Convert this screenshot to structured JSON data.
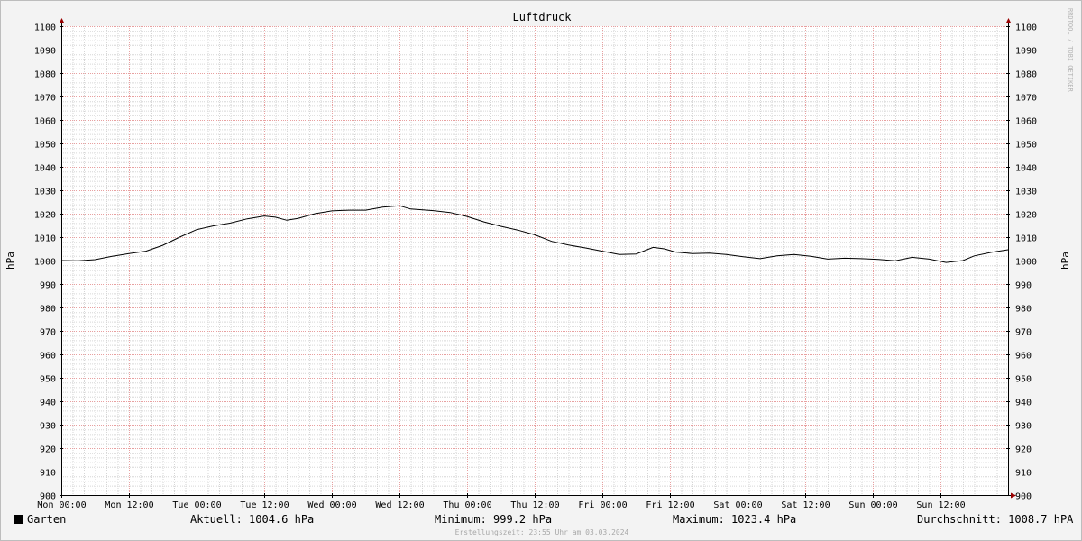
{
  "chart_data": {
    "type": "line",
    "title": "Luftdruck",
    "ylabel": "hPa",
    "ylabel_right": "hPa",
    "ylim": [
      900,
      1100
    ],
    "y_ticks": [
      900,
      910,
      920,
      930,
      940,
      950,
      960,
      970,
      980,
      990,
      1000,
      1010,
      1020,
      1030,
      1040,
      1050,
      1060,
      1070,
      1080,
      1090,
      1100
    ],
    "xlim_hours": [
      0,
      168
    ],
    "x_ticks": [
      {
        "label": "Mon 00:00",
        "hour": 0
      },
      {
        "label": "Mon 12:00",
        "hour": 12
      },
      {
        "label": "Tue 00:00",
        "hour": 24
      },
      {
        "label": "Tue 12:00",
        "hour": 36
      },
      {
        "label": "Wed 00:00",
        "hour": 48
      },
      {
        "label": "Wed 12:00",
        "hour": 60
      },
      {
        "label": "Thu 00:00",
        "hour": 72
      },
      {
        "label": "Thu 12:00",
        "hour": 84
      },
      {
        "label": "Fri 00:00",
        "hour": 96
      },
      {
        "label": "Fri 12:00",
        "hour": 108
      },
      {
        "label": "Sat 00:00",
        "hour": 120
      },
      {
        "label": "Sat 12:00",
        "hour": 132
      },
      {
        "label": "Sun 00:00",
        "hour": 144
      },
      {
        "label": "Sun 12:00",
        "hour": 156
      }
    ],
    "grid": true,
    "colors": {
      "background": "#f3f3f3",
      "plot": "#ffffff",
      "grid_minor": "#d6d6d6",
      "grid_major": "#e8a0a0",
      "axis": "#000000",
      "line": "#000000",
      "arrow": "#990000"
    },
    "series": [
      {
        "name": "Garten",
        "color": "#000000",
        "x": [
          0,
          3,
          6,
          9,
          12,
          15,
          18,
          21,
          24,
          27,
          30,
          33,
          36,
          38,
          40,
          42,
          45,
          48,
          51,
          54,
          57,
          60,
          62,
          66,
          69,
          72,
          75,
          78,
          81,
          84,
          87,
          90,
          93,
          96,
          99,
          102,
          105,
          107,
          109,
          112,
          115,
          118,
          121,
          124,
          127,
          130,
          133,
          136,
          139,
          142,
          145,
          148,
          151,
          154,
          157,
          160,
          162,
          165,
          168
        ],
        "y": [
          1000.0,
          999.9,
          1000.4,
          1001.8,
          1003.0,
          1004.0,
          1006.5,
          1010.0,
          1013.2,
          1014.8,
          1016.0,
          1017.8,
          1019.0,
          1018.5,
          1017.2,
          1018.0,
          1020.0,
          1021.2,
          1021.5,
          1021.5,
          1022.8,
          1023.4,
          1022.0,
          1021.3,
          1020.5,
          1018.8,
          1016.5,
          1014.6,
          1013.0,
          1011.0,
          1008.2,
          1006.6,
          1005.4,
          1004.0,
          1002.6,
          1002.8,
          1005.6,
          1005.0,
          1003.6,
          1003.0,
          1003.2,
          1002.6,
          1001.6,
          1000.8,
          1002.0,
          1002.6,
          1001.8,
          1000.6,
          1001.0,
          1000.8,
          1000.5,
          999.9,
          1001.4,
          1000.6,
          999.2,
          1000.0,
          1002.0,
          1003.5,
          1004.6
        ]
      }
    ]
  },
  "watermark": "RRDTOOL / TOBI OETIKER",
  "legend": {
    "series_name": "Garten",
    "current": "Aktuell: 1004.6 hPa",
    "minimum": "Minimum: 999.2 hPa",
    "maximum": "Maximum: 1023.4 hPa",
    "average": "Durchschnitt: 1008.7 hPA"
  },
  "footer": "Erstellungszeit: 23:55 Uhr am 03.03.2024"
}
